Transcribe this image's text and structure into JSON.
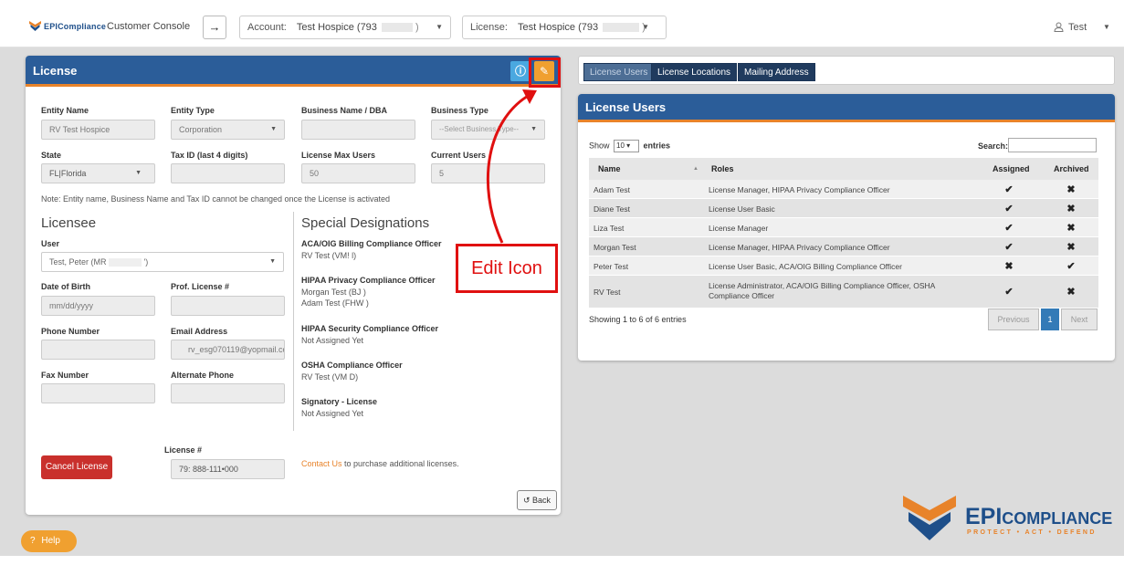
{
  "topbar": {
    "brand": "EPICompliance",
    "console_label": "Customer Console",
    "go_arrow": "→",
    "account_label": "Account:",
    "account_value": "Test Hospice (793",
    "license_label": "License:",
    "license_value": "Test Hospice (793",
    "user_name": "Test"
  },
  "license_panel": {
    "title": "License",
    "fields": {
      "entity_name_label": "Entity Name",
      "entity_name_value": "RV Test Hospice",
      "entity_type_label": "Entity Type",
      "entity_type_value": "Corporation",
      "business_name_label": "Business Name / DBA",
      "business_name_value": "",
      "business_type_label": "Business Type",
      "business_type_placeholder": "--Select Business Type--",
      "state_label": "State",
      "state_value": "FL|Florida",
      "tax_id_label": "Tax ID (last 4 digits)",
      "tax_id_value": "",
      "max_users_label": "License Max Users",
      "max_users_value": "50",
      "current_users_label": "Current Users",
      "current_users_value": "5"
    },
    "note": "Note: Entity name, Business Name and Tax ID cannot be changed once the License is activated",
    "licensee": {
      "heading": "Licensee",
      "user_label": "User",
      "user_value": "Test, Peter (MR",
      "user_value_suffix": "')",
      "dob_label": "Date of Birth",
      "dob_placeholder": "mm/dd/yyyy",
      "prof_license_label": "Prof. License #",
      "phone_label": "Phone Number",
      "email_label": "Email Address",
      "email_value": "rv_esg070119@yopmail.cor",
      "fax_label": "Fax Number",
      "alt_phone_label": "Alternate Phone"
    },
    "designations": {
      "heading": "Special Designations",
      "items": [
        {
          "title": "ACA/OIG Billing Compliance Officer",
          "values": [
            "RV Test (VM!          l)"
          ]
        },
        {
          "title": "HIPAA Privacy Compliance Officer",
          "values": [
            "Morgan Test (BJ          )",
            "Adam Test (FHW          )"
          ]
        },
        {
          "title": "HIPAA Security Compliance Officer",
          "values": [
            "Not Assigned Yet"
          ]
        },
        {
          "title": "OSHA Compliance Officer",
          "values": [
            "RV Test (VM          D)"
          ]
        },
        {
          "title": "Signatory - License",
          "values": [
            "Not Assigned Yet"
          ]
        }
      ]
    },
    "cancel_label": "Cancel License",
    "license_num_label": "License #",
    "license_num_value": "79: 888-111•000",
    "contact_link": "Contact Us",
    "contact_rest": " to purchase additional licenses.",
    "back_label": "Back"
  },
  "right": {
    "tabs": [
      "License Users",
      "License Locations",
      "Mailing Address"
    ],
    "panel_title": "License Users",
    "show_label": "Show",
    "show_value": "10",
    "entries_label": "entries",
    "search_label": "Search:",
    "columns": [
      "Name",
      "Roles",
      "Assigned",
      "Archived"
    ],
    "rows": [
      {
        "name": "Adam Test",
        "roles": "License Manager, HIPAA Privacy Compliance Officer",
        "roles2": "",
        "assigned": "✔",
        "archived": "✖"
      },
      {
        "name": "Diane Test",
        "roles": "License User Basic",
        "roles2": "",
        "assigned": "✔",
        "archived": "✖"
      },
      {
        "name": "Liza Test",
        "roles": "License Manager",
        "roles2": "",
        "assigned": "✔",
        "archived": "✖"
      },
      {
        "name": "Morgan Test",
        "roles": "License Manager, HIPAA Privacy Compliance Officer",
        "roles2": "",
        "assigned": "✔",
        "archived": "✖"
      },
      {
        "name": "Peter Test",
        "roles": "License User Basic, ACA/OIG Billing Compliance Officer",
        "roles2": "",
        "assigned": "✖",
        "archived": "✔"
      },
      {
        "name": "RV Test",
        "roles": "License Administrator, ACA/OIG Billing Compliance Officer, OSHA",
        "roles2": "Compliance Officer",
        "assigned": "✔",
        "archived": "✖"
      }
    ],
    "footer_info": "Showing 1 to 6 of 6 entries",
    "prev_label": "Previous",
    "page_label": "1",
    "next_label": "Next"
  },
  "annotation": {
    "label": "Edit Icon",
    "color": "#e01010"
  },
  "footer": {
    "help_label": "Help",
    "big_brand_epi": "EPI",
    "big_brand_rest": "COMPLIANCE",
    "tagline": "PROTECT • ACT • DEFEND"
  },
  "colors": {
    "header_blue": "#2b5d99",
    "accent_orange": "#e8832a",
    "brand_blue": "#1e4f8a",
    "cancel_red": "#c9302c"
  }
}
